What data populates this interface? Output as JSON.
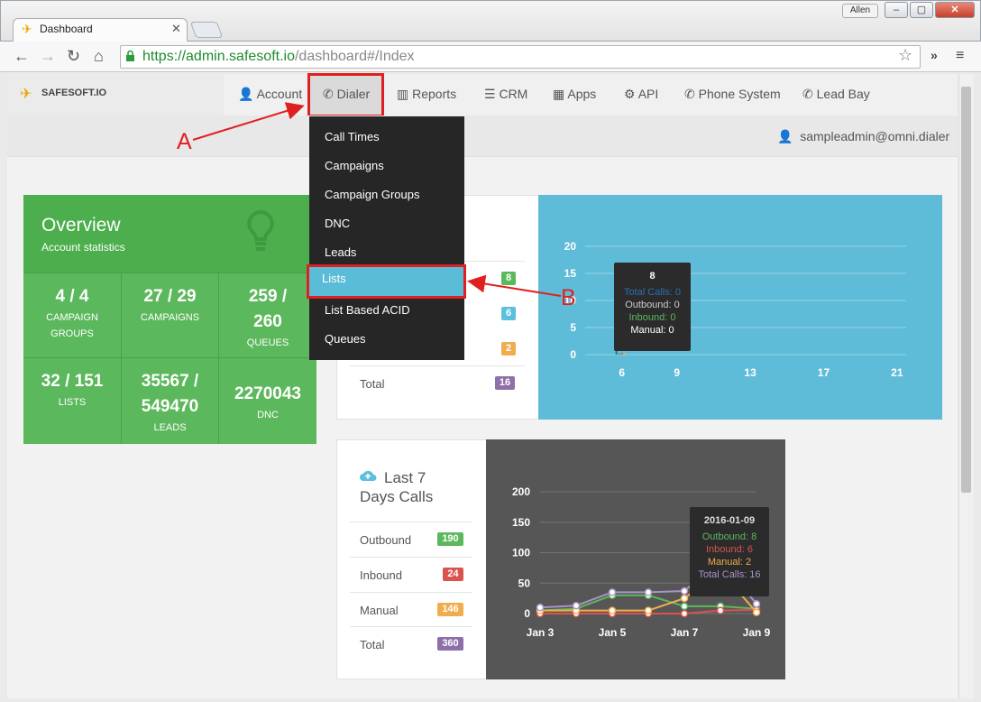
{
  "browser": {
    "tab_title": "Dashboard",
    "user_badge": "Allen",
    "url_scheme": "https://",
    "url_host": "admin.safesoft.io",
    "url_path": "/dashboard#/Index",
    "more_label": "»"
  },
  "nav": {
    "brand": "SAFESOFT.IO",
    "items": [
      "Account",
      "Dialer",
      "Reports",
      "CRM",
      "Apps",
      "API",
      "Phone System",
      "Lead Bay"
    ],
    "user": "sampleadmin@omni.dialer"
  },
  "dropdown": {
    "items": [
      "Call Times",
      "Campaigns",
      "Campaign Groups",
      "DNC",
      "Leads",
      "Lists",
      "List Based ACID",
      "Queues"
    ],
    "selected": "Lists"
  },
  "annotations": {
    "a": "A",
    "b": "B"
  },
  "overview": {
    "title": "Overview",
    "subtitle": "Account statistics",
    "cells": [
      {
        "value": "4 / 4",
        "label": "CAMPAIGN GROUPS"
      },
      {
        "value": "27 / 29",
        "label": "CAMPAIGNS"
      },
      {
        "value": "259 / 260",
        "label": "QUEUES"
      },
      {
        "value": "32 / 151",
        "label": "LISTS"
      },
      {
        "value": "35567 / 549470",
        "label": "LEADS"
      },
      {
        "value": "2270043",
        "label": "DNC"
      }
    ]
  },
  "today_panel": {
    "badges": [
      "8",
      "6",
      "2"
    ],
    "total_label": "Total",
    "total_value": "16",
    "colors": {
      "green": "#5cb85c",
      "blue": "#5bc0de",
      "orange": "#f0ad4e",
      "purple": "#8e6fa9"
    }
  },
  "week_panel": {
    "title": "Last 7 Days Calls",
    "rows": [
      {
        "label": "Outbound",
        "value": "190",
        "color": "#5cb85c"
      },
      {
        "label": "Inbound",
        "value": "24",
        "color": "#d9534f"
      },
      {
        "label": "Manual",
        "value": "146",
        "color": "#f0ad4e"
      },
      {
        "label": "Total",
        "value": "360",
        "color": "#8e6fa9"
      }
    ]
  },
  "chart_data": [
    {
      "type": "bar",
      "y_ticks": [
        "20",
        "15",
        "10",
        "5",
        "0"
      ],
      "x_ticks": [
        "6",
        "9",
        "13",
        "17",
        "21"
      ],
      "ylim": [
        0,
        20
      ],
      "grid": true,
      "tooltip": {
        "title": "8",
        "lines": [
          "Total Calls: 0",
          "Outbound: 0",
          "Inbound: 0",
          "Manual: 0"
        ]
      },
      "series": [
        {
          "name": "Total Calls",
          "color": "#2a6fb0"
        },
        {
          "name": "Outbound",
          "color": "#5cb85c"
        },
        {
          "name": "Inbound",
          "color": "#d9534f"
        },
        {
          "name": "Manual",
          "color": "#f0ad4e"
        }
      ]
    },
    {
      "type": "line",
      "title": "Last 7 Days Calls",
      "y_ticks": [
        "200",
        "150",
        "100",
        "50",
        "0"
      ],
      "x_ticks": [
        "Jan 3",
        "Jan 5",
        "Jan 7",
        "Jan 9"
      ],
      "ylim": [
        0,
        200
      ],
      "grid": true,
      "x": [
        "Jan 3",
        "Jan 4",
        "Jan 5",
        "Jan 6",
        "Jan 7",
        "Jan 8",
        "Jan 9"
      ],
      "series": [
        {
          "name": "Outbound",
          "color": "#5cb85c",
          "values": [
            5,
            8,
            30,
            30,
            12,
            12,
            8
          ]
        },
        {
          "name": "Inbound",
          "color": "#d9534f",
          "values": [
            0,
            0,
            0,
            0,
            0,
            5,
            6
          ]
        },
        {
          "name": "Manual",
          "color": "#f0ad4e",
          "values": [
            5,
            5,
            5,
            5,
            25,
            70,
            2
          ]
        },
        {
          "name": "Total Calls",
          "color": "#a993c9",
          "values": [
            10,
            13,
            35,
            35,
            37,
            87,
            16
          ]
        }
      ],
      "tooltip": {
        "title": "2016-01-09",
        "lines": [
          "Outbound: 8",
          "Inbound: 6",
          "Manual: 2",
          "Total Calls: 16"
        ]
      }
    }
  ]
}
